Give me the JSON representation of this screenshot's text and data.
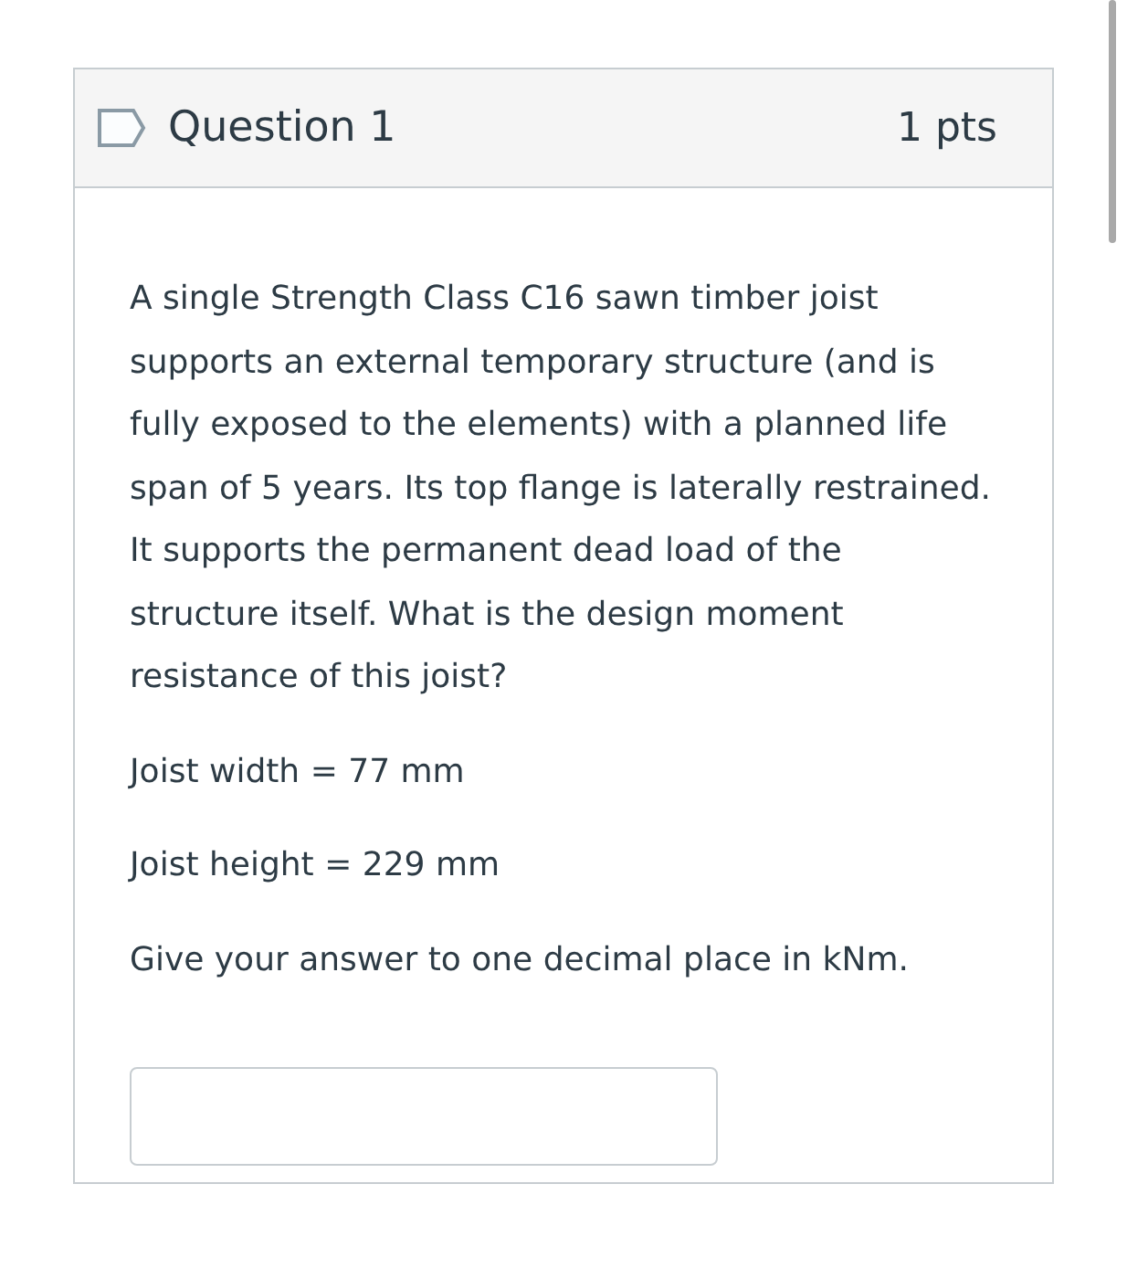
{
  "question": {
    "title": "Question 1",
    "points": "1 pts",
    "paragraphs": [
      "A single Strength Class C16 sawn timber joist supports an external temporary structure (and is fully exposed to the elements) with a planned life span of 5 years. Its top flange is laterally restrained. It supports the permanent dead load of the structure itself. What is the design moment resistance of this joist?",
      "Joist width = 77 mm",
      "Joist height = 229 mm",
      "Give your answer to one decimal place in kNm."
    ]
  }
}
